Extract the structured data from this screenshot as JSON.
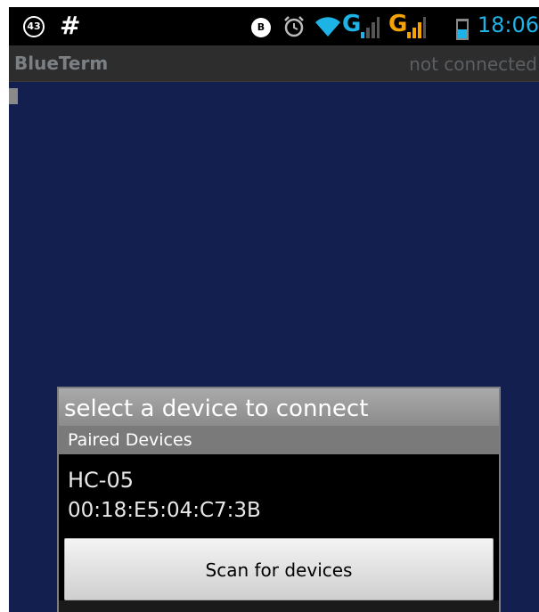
{
  "status_bar": {
    "notification_count": "43",
    "hash_icon": "#",
    "vpn_icon": "B",
    "network_label_1": "G",
    "network_label_2": "G",
    "time": "18:06",
    "accent_color": "#1eb3e6",
    "secondary_color": "#f5a300"
  },
  "title_bar": {
    "app_name": "BlueTerm",
    "connection_status": "not connected"
  },
  "dialog": {
    "title": "select a device to connect",
    "section_header": "Paired Devices",
    "devices": [
      {
        "name": "HC-05",
        "address": "00:18:E5:04:C7:3B"
      }
    ],
    "scan_button_label": "Scan for devices"
  },
  "colors": {
    "terminal_background": "#13204f",
    "dialog_background": "#000000"
  }
}
